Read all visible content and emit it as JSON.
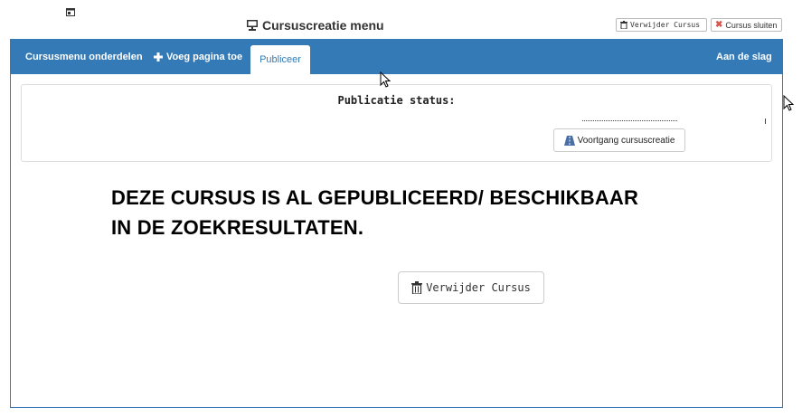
{
  "header": {
    "title": "Cursuscreatie menu",
    "delete_label": "Verwijder Cursus",
    "close_label": "Cursus sluiten"
  },
  "nav": {
    "items": [
      {
        "label": "Cursusmenu onderdelen",
        "icon": "none"
      },
      {
        "label": "Voeg pagina toe",
        "icon": "plus-icon"
      },
      {
        "label": "Publiceer",
        "icon": "none"
      },
      {
        "label": "Aan de slag",
        "icon": "none"
      }
    ],
    "active": "Publiceer"
  },
  "status": {
    "title": "Publicatie status:",
    "progress_button": "Voortgang cursuscreatie"
  },
  "notice": {
    "line1": "DEZE CURSUS IS AL GEPUBLICEERD/ BESCHIKBAAR",
    "line2": "IN DE ZOEKRESULTATEN."
  },
  "main": {
    "delete_button": "Verwijder Cursus"
  },
  "colors": {
    "primary": "#337ab7",
    "close_icon": "#d9534f"
  }
}
